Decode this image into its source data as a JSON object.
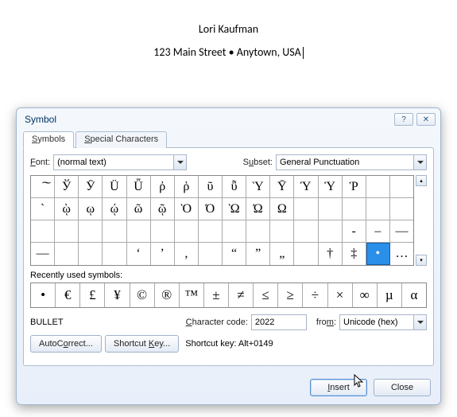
{
  "document": {
    "line1": "Lori Kaufman",
    "line2": "123 Main Street • Anytown, USA"
  },
  "dialog": {
    "title": "Symbol",
    "help_label": "?",
    "close_label": "✕",
    "tabs": {
      "symbols": "Symbols",
      "special": "Special Characters"
    },
    "font_label": "Font:",
    "font_value": "(normal text)",
    "subset_label": "Subset:",
    "subset_value": "General Punctuation",
    "grid": [
      [
        "͠",
        "Ў",
        "Ӯ",
        "Ü",
        "Ǖ",
        "ῤ",
        "ῥ",
        "ῦ",
        "ῧ",
        "Ὺ",
        "Ῡ",
        "Ύ",
        "Ὑ",
        "Ῥ",
        "",
        ""
      ],
      [
        "`",
        "ῲ",
        "ῳ",
        "ῴ",
        "ῶ",
        "ῷ",
        "Ὸ",
        "Ό",
        "Ὼ",
        "Ώ",
        "Ω",
        "",
        "",
        "",
        "",
        ""
      ],
      [
        "",
        "",
        "",
        "",
        "",
        "",
        "",
        "",
        "",
        "",
        "",
        "",
        "",
        "-",
        "–",
        "—"
      ],
      [
        "―",
        "",
        "",
        "",
        "‘",
        "’",
        "‚",
        "",
        "“",
        "”",
        "„",
        "",
        "†",
        "‡",
        "•",
        "…"
      ]
    ],
    "selected_row": 3,
    "selected_col": 14,
    "recent_label": "Recently used symbols:",
    "recent": [
      "•",
      "€",
      "£",
      "¥",
      "©",
      "®",
      "™",
      "±",
      "≠",
      "≤",
      "≥",
      "÷",
      "×",
      "∞",
      "µ",
      "α"
    ],
    "char_name": "BULLET",
    "code_label": "Character code:",
    "code_value": "2022",
    "from_label": "from:",
    "from_value": "Unicode (hex)",
    "autocorrect_label": "AutoCorrect...",
    "shortcutkey_label": "Shortcut Key...",
    "shortcut_text": "Shortcut key: Alt+0149",
    "insert": "Insert",
    "close": "Close"
  }
}
